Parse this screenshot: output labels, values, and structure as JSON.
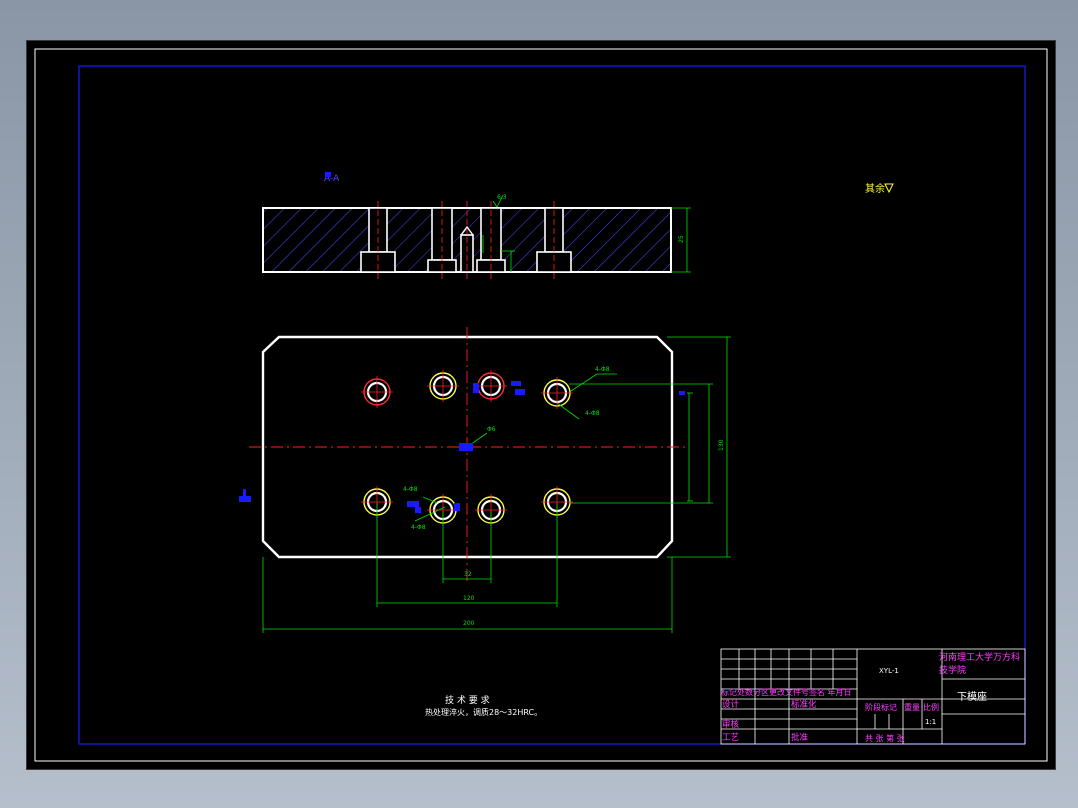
{
  "labels": {
    "section_mark": "A-A",
    "roughness_note": "其余",
    "roughness_surface": "6.3",
    "tech_req_title": "技 术 要 求",
    "tech_req_text": "热处理淬火，调质28～32HRC。",
    "hole_label_1": "4-Φ8",
    "hole_label_2": "4-Φ8",
    "hole_label_3": "4-Φ8",
    "hole_label_4": "4-Φ8",
    "center_label": "Φ6",
    "view_arrow_label": "A",
    "dim_top_height": "25",
    "dim_width_total": "200",
    "dim_holes_span": "120",
    "dim_inner": "32",
    "dim_height_total": "130"
  },
  "title_block": {
    "drawing_no": "XYL-1",
    "school_line1": "河南理工大学万方科",
    "school_line2": "技学院",
    "part_name": "下模座",
    "revision_header": "标记处数分区更改文件号签名 年月日",
    "designer_label": "设计",
    "standardize_label": "标准化",
    "review_label": "审核",
    "process_label": "工艺",
    "approve_label": "批准",
    "stage_mark_label": "阶段标记",
    "weight_label": "重量",
    "scale_label": "比例",
    "scale_value": "1:1",
    "sheets_label": "共   张 第   张"
  },
  "colors": {
    "background": "#000000",
    "outline": "#ffffff",
    "center_line": "#ff2020",
    "dimension": "#00e000",
    "frame": "#1a1aff",
    "hatch": "#4a4aff",
    "title_text": "#ff40ff",
    "yellow_text": "#ffff40"
  }
}
